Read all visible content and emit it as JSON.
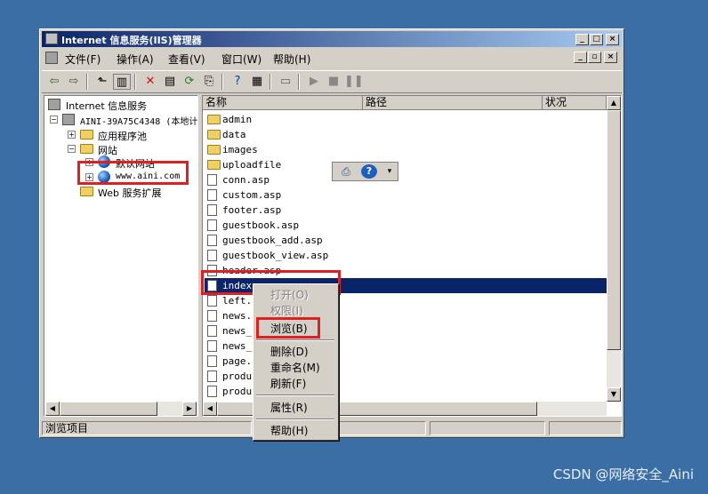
{
  "window": {
    "title": "Internet 信息服务(IIS)管理器",
    "caption_buttons": [
      "_",
      "□",
      "×"
    ],
    "mdi_buttons": [
      "_",
      "▫",
      "×"
    ]
  },
  "menu": {
    "items": [
      "文件(F)",
      "操作(A)",
      "查看(V)",
      "窗口(W)",
      "帮助(H)"
    ]
  },
  "tree": {
    "root": "Internet 信息服务",
    "server": "AINI-39A75C4348 (本地计",
    "app_pools": "应用程序池",
    "websites": "网站",
    "default_site": "默认网站",
    "aini_site": "www.aini.com",
    "web_ext": "Web 服务扩展"
  },
  "list": {
    "columns": [
      "名称",
      "路径",
      "状况"
    ],
    "rows": [
      {
        "name": "admin",
        "type": "folder"
      },
      {
        "name": "data",
        "type": "folder"
      },
      {
        "name": "images",
        "type": "folder"
      },
      {
        "name": "uploadfile",
        "type": "folder"
      },
      {
        "name": "conn.asp",
        "type": "file"
      },
      {
        "name": "custom.asp",
        "type": "file"
      },
      {
        "name": "footer.asp",
        "type": "file"
      },
      {
        "name": "guestbook.asp",
        "type": "file"
      },
      {
        "name": "guestbook_add.asp",
        "type": "file"
      },
      {
        "name": "guestbook_view.asp",
        "type": "file"
      },
      {
        "name": "header.asp",
        "type": "file"
      },
      {
        "name": "index.asp",
        "type": "file",
        "selected": true
      },
      {
        "name": "left.a",
        "type": "file"
      },
      {
        "name": "news.a",
        "type": "file"
      },
      {
        "name": "news_c",
        "type": "file"
      },
      {
        "name": "news_v",
        "type": "file"
      },
      {
        "name": "page.a",
        "type": "file"
      },
      {
        "name": "produc",
        "type": "file"
      },
      {
        "name": "produc",
        "type": "file"
      }
    ]
  },
  "context_menu": {
    "open": "打开(O)",
    "permissions": "权限(I)",
    "browse": "浏览(B)",
    "delete": "删除(D)",
    "rename": "重命名(M)",
    "refresh": "刷新(F)",
    "properties": "属性(R)",
    "help": "帮助(H)"
  },
  "status": {
    "text": "浏览项目"
  },
  "watermark": "CSDN @网络安全_Aini",
  "colors": {
    "desktop": "#3a6ea5",
    "titlebar_start": "#0a246a",
    "selection": "#0a246a",
    "highlight_box": "#e02020"
  }
}
